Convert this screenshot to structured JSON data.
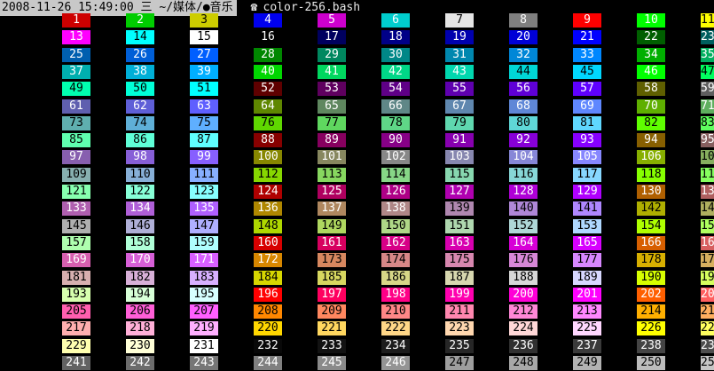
{
  "window": {
    "datetime": "2008-11-26 15:49:00 三",
    "path": "~/媒体/",
    "path_tail": "●音乐",
    "command_icon": "shell-icon",
    "command": "color-256.bash"
  },
  "palette": {
    "standard": [
      "#000000",
      "#cd0000",
      "#00cd00",
      "#cdcd00",
      "#0000ee",
      "#cd00cd",
      "#00cdcd",
      "#e5e5e5",
      "#7f7f7f",
      "#ff0000",
      "#00ff00",
      "#ffff00",
      "#5c5cff",
      "#ff00ff",
      "#00ffff",
      "#ffffff"
    ],
    "cube_levels": [
      0,
      95,
      135,
      175,
      215,
      255
    ]
  },
  "cells_visible_start": 1,
  "cells_visible_end": 255,
  "column_count": 12,
  "row_count": 22
}
